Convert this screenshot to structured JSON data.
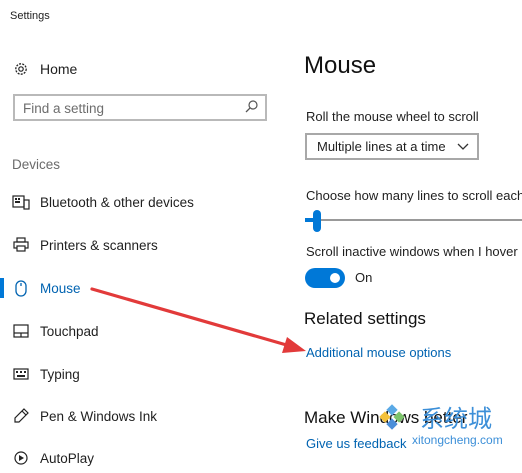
{
  "window": {
    "title": "Settings"
  },
  "sidebar": {
    "home_label": "Home",
    "search_placeholder": "Find a setting",
    "section_heading": "Devices",
    "items": [
      {
        "label": "Bluetooth & other devices",
        "icon": "bluetooth-keyboard-icon"
      },
      {
        "label": "Printers & scanners",
        "icon": "printer-icon"
      },
      {
        "label": "Mouse",
        "icon": "mouse-icon",
        "active": true
      },
      {
        "label": "Touchpad",
        "icon": "touchpad-icon"
      },
      {
        "label": "Typing",
        "icon": "keyboard-icon"
      },
      {
        "label": "Pen & Windows Ink",
        "icon": "pen-icon"
      },
      {
        "label": "AutoPlay",
        "icon": "autoplay-icon"
      }
    ]
  },
  "main": {
    "title": "Mouse",
    "scroll_wheel_label": "Roll the mouse wheel to scroll",
    "scroll_wheel_value": "Multiple lines at a time",
    "lines_label": "Choose how many lines to scroll each",
    "lines_slider_fraction": 0.04,
    "inactive_label": "Scroll inactive windows when I hover",
    "inactive_toggle_state": "On",
    "related_title": "Related settings",
    "additional_link": "Additional mouse options",
    "make_title": "Make Windows better",
    "feedback_link": "Give us feedback"
  },
  "watermark": {
    "brand_text": "系统城",
    "url_text": "xitongcheng.com"
  },
  "colors": {
    "accent": "#0078d7",
    "link": "#0063b1",
    "annotation_arrow": "#e23a3a"
  }
}
